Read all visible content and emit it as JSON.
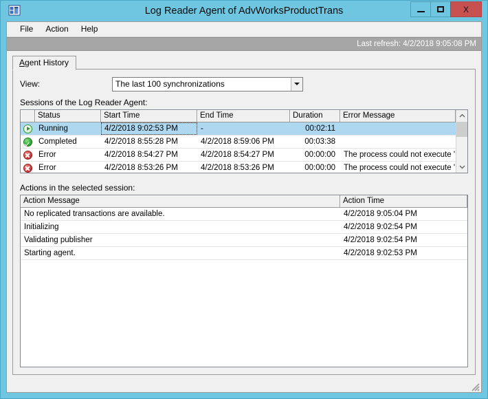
{
  "window": {
    "title": "Log Reader Agent of AdvWorksProductTrans",
    "icon": "app-icon",
    "buttons": {
      "minimize": "minimize",
      "maximize": "maximize",
      "close": "X"
    }
  },
  "menu": {
    "items": [
      {
        "label": "File"
      },
      {
        "label": "Action"
      },
      {
        "label": "Help"
      }
    ]
  },
  "refresh": {
    "text": "Last refresh: 4/2/2018 9:05:08 PM"
  },
  "tabs": [
    {
      "label": "Agent History",
      "accel": "A",
      "rest": "gent History",
      "selected": true
    }
  ],
  "view": {
    "label": "View:",
    "value": "The last 100 synchronizations"
  },
  "sessions": {
    "caption": "Sessions of the Log Reader Agent:",
    "columns": [
      "",
      "Status",
      "Start Time",
      "End Time",
      "Duration",
      "Error Message"
    ],
    "rows": [
      {
        "icon": "status-running-icon",
        "status": "Running",
        "start": "4/2/2018 9:02:53 PM",
        "end": "-",
        "duration": "00:02:11",
        "error": "",
        "selected": true
      },
      {
        "icon": "status-completed-icon",
        "status": "Completed",
        "start": "4/2/2018 8:55:28 PM",
        "end": "4/2/2018 8:59:06 PM",
        "duration": "00:03:38",
        "error": "",
        "selected": false
      },
      {
        "icon": "status-error-icon",
        "status": "Error",
        "start": "4/2/2018 8:54:27 PM",
        "end": "4/2/2018 8:54:27 PM",
        "duration": "00:00:00",
        "error": "The process could not execute '...",
        "selected": false
      },
      {
        "icon": "status-error-icon",
        "status": "Error",
        "start": "4/2/2018 8:53:26 PM",
        "end": "4/2/2018 8:53:26 PM",
        "duration": "00:00:00",
        "error": "The process could not execute '...",
        "selected": false
      }
    ]
  },
  "actions": {
    "caption": "Actions in the selected session:",
    "columns": [
      "Action Message",
      "Action Time"
    ],
    "rows": [
      {
        "message": "No replicated transactions are available.",
        "time": "4/2/2018 9:05:04 PM"
      },
      {
        "message": "Initializing",
        "time": "4/2/2018 9:02:54 PM"
      },
      {
        "message": "Validating publisher",
        "time": "4/2/2018 9:02:54 PM"
      },
      {
        "message": "Starting agent.",
        "time": "4/2/2018 9:02:53 PM"
      }
    ]
  },
  "colors": {
    "window_frame": "#6ec6e0",
    "close_button": "#c75050",
    "selection": "#add8f0",
    "refresh_bar": "#a6a6a6",
    "dialog_face": "#f0f0f0"
  }
}
